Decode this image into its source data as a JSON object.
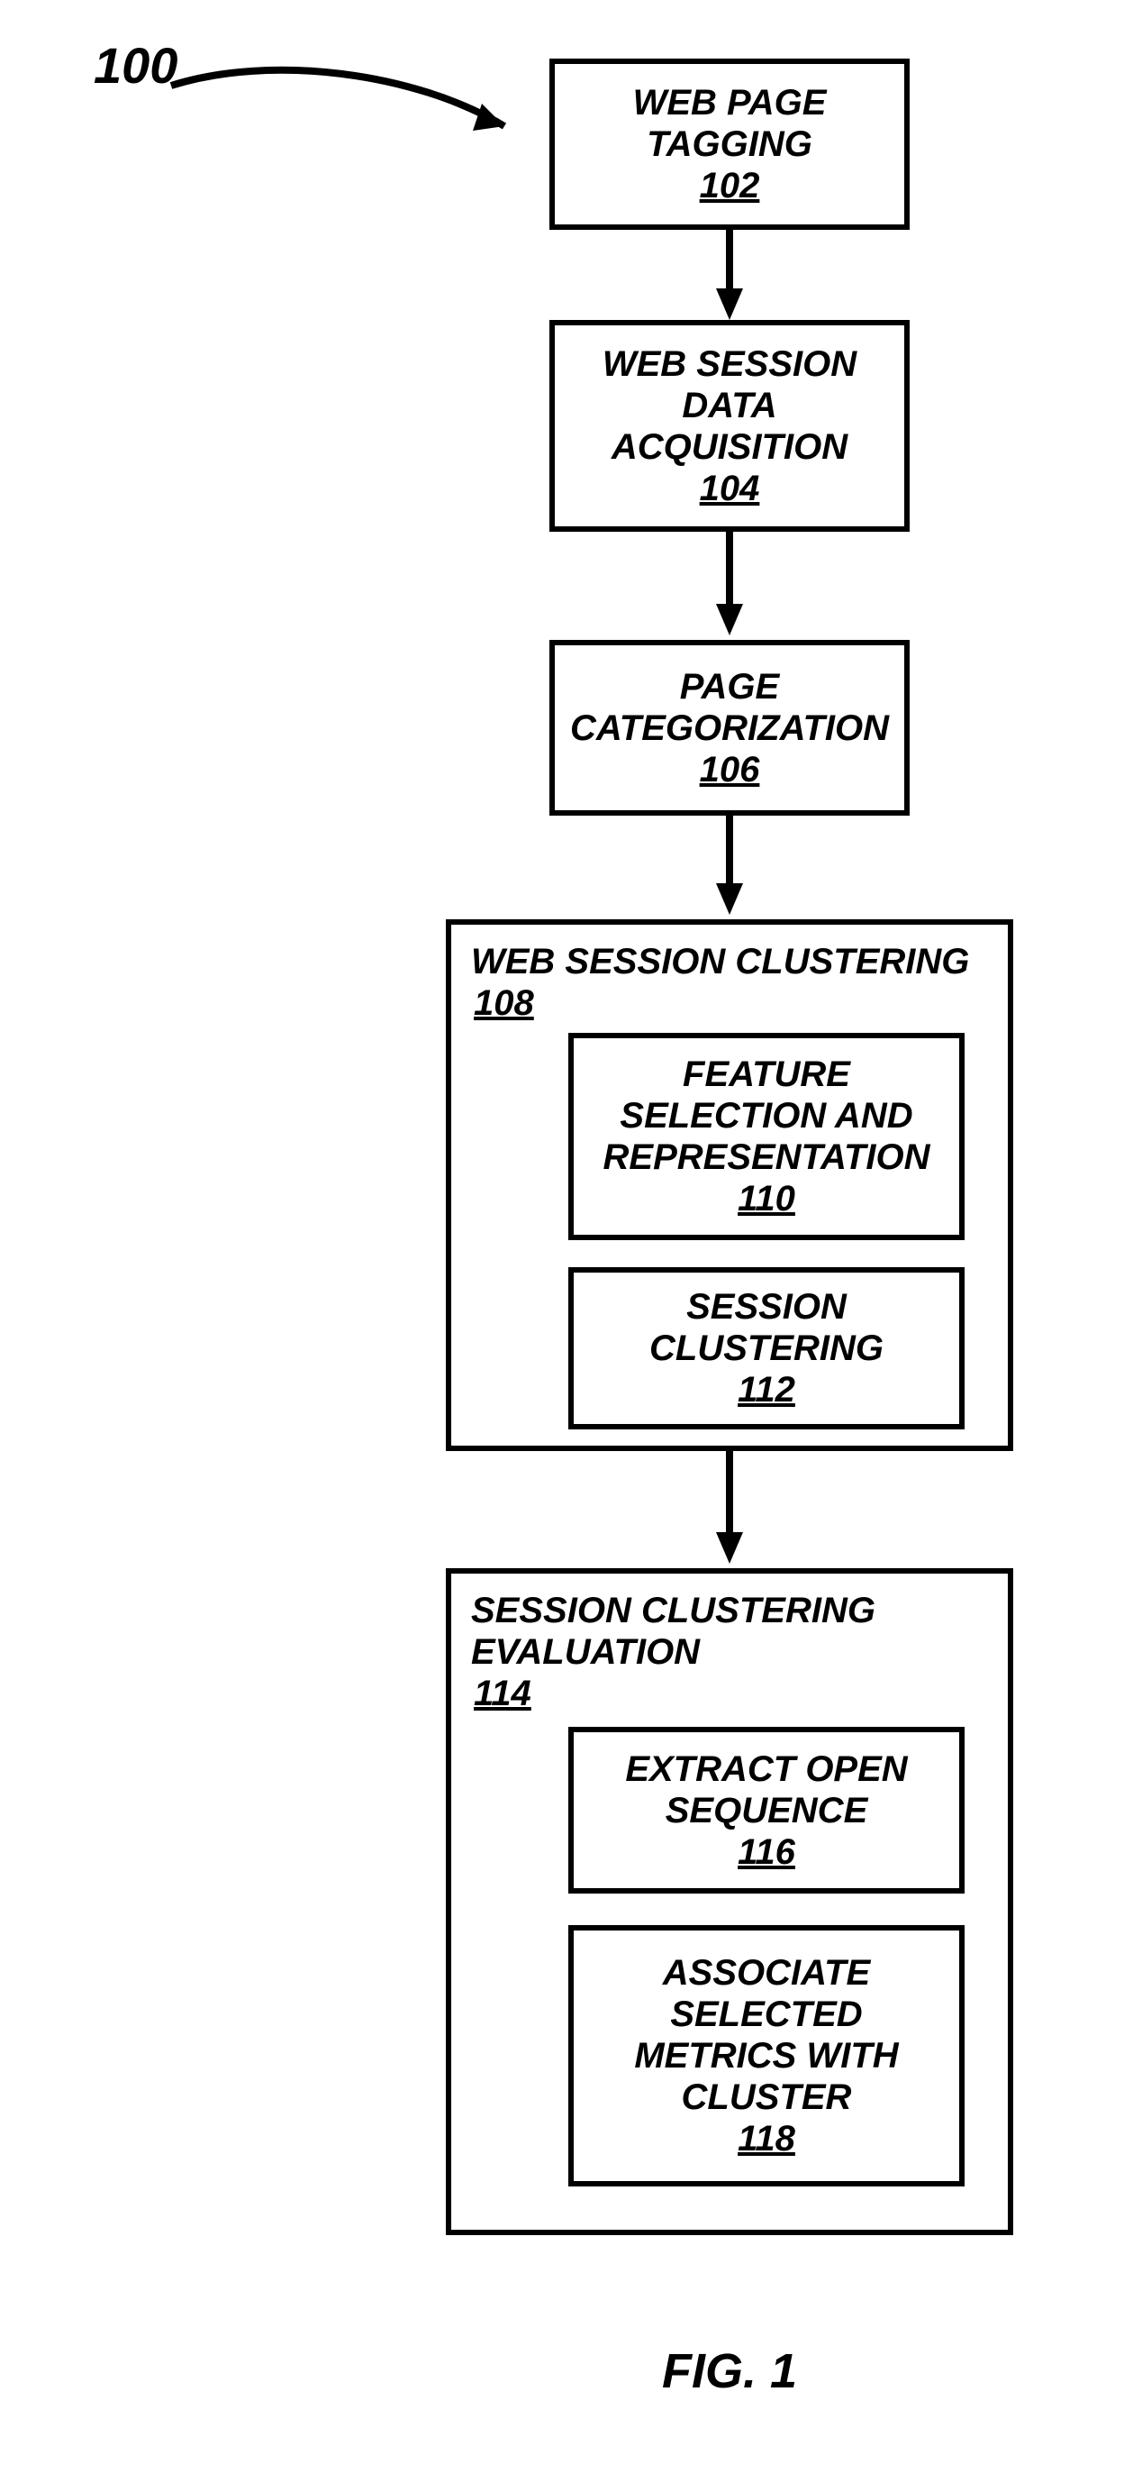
{
  "refNumber": "100",
  "figureLabel": "FIG. 1",
  "boxes": {
    "b102": {
      "title": "WEB PAGE TAGGING",
      "num": "102"
    },
    "b104": {
      "title": "WEB SESSION DATA ACQUISITION",
      "num": "104"
    },
    "b106": {
      "title": "PAGE CATEGORIZATION",
      "num": "106"
    },
    "b108": {
      "title": "WEB SESSION CLUSTERING",
      "num": "108"
    },
    "b110": {
      "title": "FEATURE SELECTION AND REPRESENTATION",
      "num": "110"
    },
    "b112": {
      "title": "SESSION CLUSTERING",
      "num": "112"
    },
    "b114": {
      "title": "SESSION CLUSTERING EVALUATION",
      "num": "114"
    },
    "b116": {
      "title": "EXTRACT OPEN SEQUENCE",
      "num": "116"
    },
    "b118": {
      "title": "ASSOCIATE SELECTED METRICS WITH CLUSTER",
      "num": "118"
    }
  },
  "chart_data": {
    "type": "flowchart",
    "nodes": [
      {
        "id": "102",
        "label": "WEB PAGE TAGGING"
      },
      {
        "id": "104",
        "label": "WEB SESSION DATA ACQUISITION"
      },
      {
        "id": "106",
        "label": "PAGE CATEGORIZATION"
      },
      {
        "id": "108",
        "label": "WEB SESSION CLUSTERING",
        "children": [
          {
            "id": "110",
            "label": "FEATURE SELECTION AND REPRESENTATION"
          },
          {
            "id": "112",
            "label": "SESSION CLUSTERING"
          }
        ]
      },
      {
        "id": "114",
        "label": "SESSION CLUSTERING EVALUATION",
        "children": [
          {
            "id": "116",
            "label": "EXTRACT OPEN SEQUENCE"
          },
          {
            "id": "118",
            "label": "ASSOCIATE SELECTED METRICS WITH CLUSTER"
          }
        ]
      }
    ],
    "edges": [
      {
        "from": "102",
        "to": "104"
      },
      {
        "from": "104",
        "to": "106"
      },
      {
        "from": "106",
        "to": "108"
      },
      {
        "from": "108",
        "to": "114"
      }
    ],
    "referencePointer": {
      "label": "100",
      "pointsTo": "flowchart"
    }
  }
}
